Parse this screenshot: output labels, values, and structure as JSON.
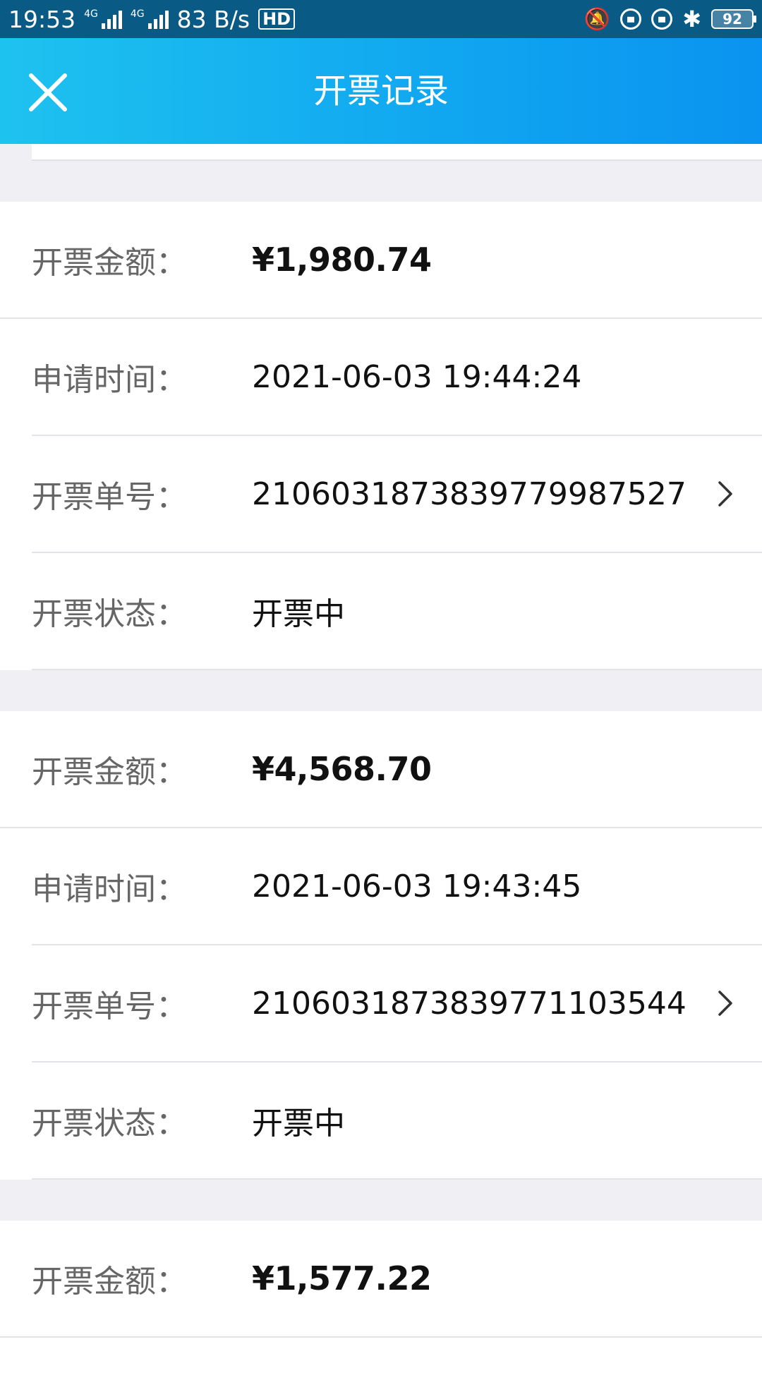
{
  "status_bar": {
    "time": "19:53",
    "network_speed": "83 B/s",
    "signal_label": "4G",
    "hd_label": "HD",
    "battery": "92"
  },
  "header": {
    "title": "开票记录"
  },
  "labels": {
    "amount": "开票金额：",
    "time": "申请时间：",
    "number": "开票单号：",
    "status": "开票状态："
  },
  "records": [
    {
      "amount": "¥1,980.74",
      "time": "2021-06-03 19:44:24",
      "number": "2106031873839779987527",
      "status": "开票中"
    },
    {
      "amount": "¥4,568.70",
      "time": "2021-06-03 19:43:45",
      "number": "2106031873839771103544",
      "status": "开票中"
    },
    {
      "amount": "¥1,577.22"
    }
  ]
}
